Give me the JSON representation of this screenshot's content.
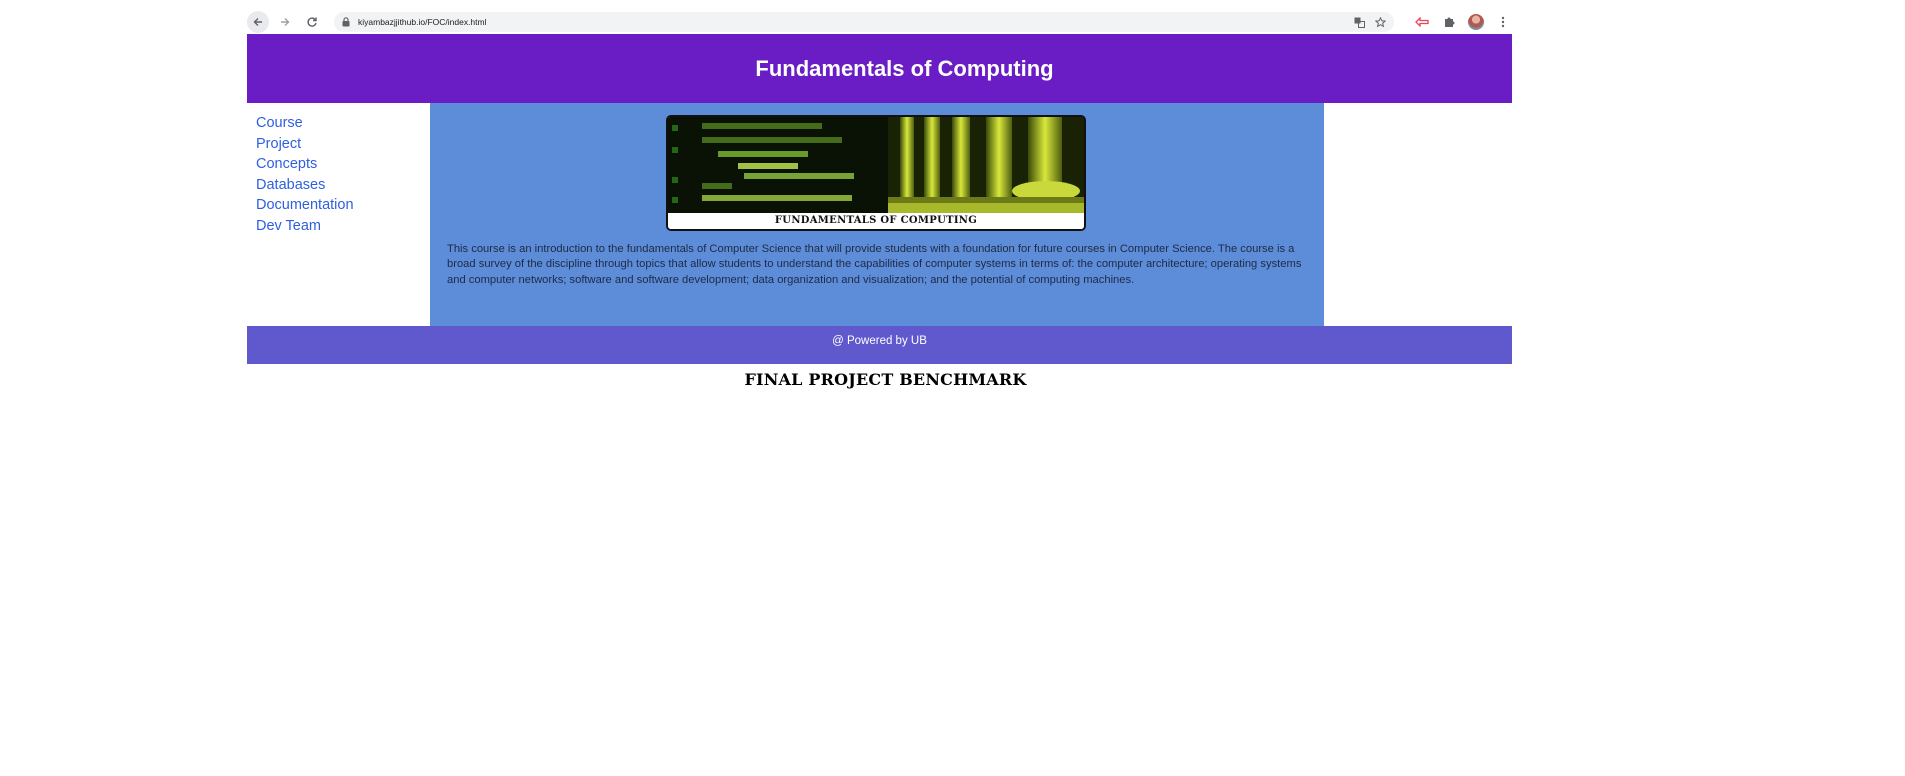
{
  "browser": {
    "url": "kiyambazjjithub.io/FOC/index.html",
    "icons": [
      "back-arrow-icon",
      "forward-arrow-icon",
      "reload-icon",
      "lock-icon",
      "translate-icon",
      "star-icon",
      "extension-cast-icon",
      "puzzle-icon",
      "avatar",
      "kebab-menu-icon"
    ]
  },
  "header": {
    "title": "Fundamentals of Computing",
    "background": "#6a1dc5"
  },
  "sidebar": {
    "items": [
      {
        "label": "Course"
      },
      {
        "label": "Project"
      },
      {
        "label": "Concepts"
      },
      {
        "label": "Databases"
      },
      {
        "label": "Documentation"
      },
      {
        "label": "Dev Team"
      }
    ],
    "link_color": "#2f5fe0"
  },
  "main": {
    "background": "#5d8dd9",
    "banner_caption": "FUNDAMENTALS OF COMPUTING",
    "description": "This course is an introduction to the fundamentals of Computer Science that will provide students with a foundation for future courses in Computer Science. The course is a broad survey of the discipline through topics that allow students to understand the capabilities of computer systems in terms of: the computer architecture; operating systems and computer networks; software and software development; data organization and visualization; and the potential of computing machines."
  },
  "footer": {
    "text": "@ Powered by UB",
    "background": "#6059cd"
  },
  "below_footer": {
    "heading": "FINAL PROJECT BENCHMARK"
  }
}
